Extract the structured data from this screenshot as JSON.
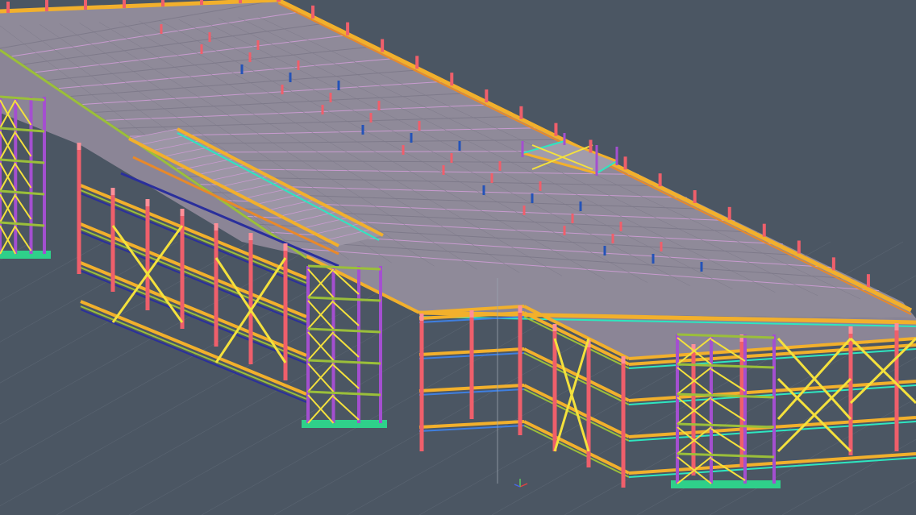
{
  "viewport": {
    "background": "#4b5663",
    "grid_color": "#5a6572"
  },
  "palette": {
    "deck": "#8f8a99",
    "deck_line": "#c99bd0",
    "deck_line_alt": "#7e7a8a",
    "beam_yellow": "#f2b02c",
    "beam_orange": "#e8892a",
    "beam_green": "#9bbf3a",
    "beam_cyan": "#2ee6c0",
    "column_red": "#ef5f6b",
    "column_purple": "#a44fd0",
    "brace_yellow": "#f4e13c",
    "beam_navy": "#2a2f9c",
    "beam_blue": "#3f7fe0",
    "stair_green": "#2fd08a",
    "post_blue": "#2453b8",
    "axis_x": "#e74040",
    "axis_y": "#5fcf5f",
    "axis_z": "#4a68e8"
  },
  "icons": {
    "ucs": "ucs-axis-icon",
    "crosshair": "cursor-crosshair-icon"
  }
}
